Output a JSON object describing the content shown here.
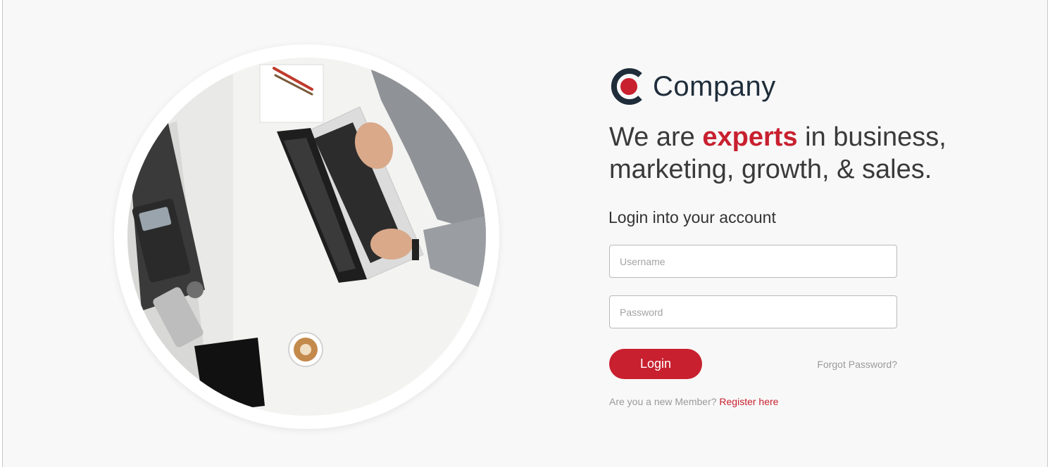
{
  "brand": {
    "name": "Company",
    "primary_color": "#c8202f",
    "dark_color": "#1f2d3a",
    "logo_icon": "company-c-logo"
  },
  "headline": {
    "before": "We are ",
    "accent": "experts",
    "after": " in business, marketing, growth, & sales."
  },
  "login": {
    "title": "Login into your account",
    "username_placeholder": "Username",
    "password_placeholder": "Password",
    "button_label": "Login",
    "forgot_label": "Forgot Password?",
    "register_prompt": "Are you a new Member? ",
    "register_link": "Register here"
  },
  "hero_image": {
    "subject": "office-desk-photo"
  }
}
